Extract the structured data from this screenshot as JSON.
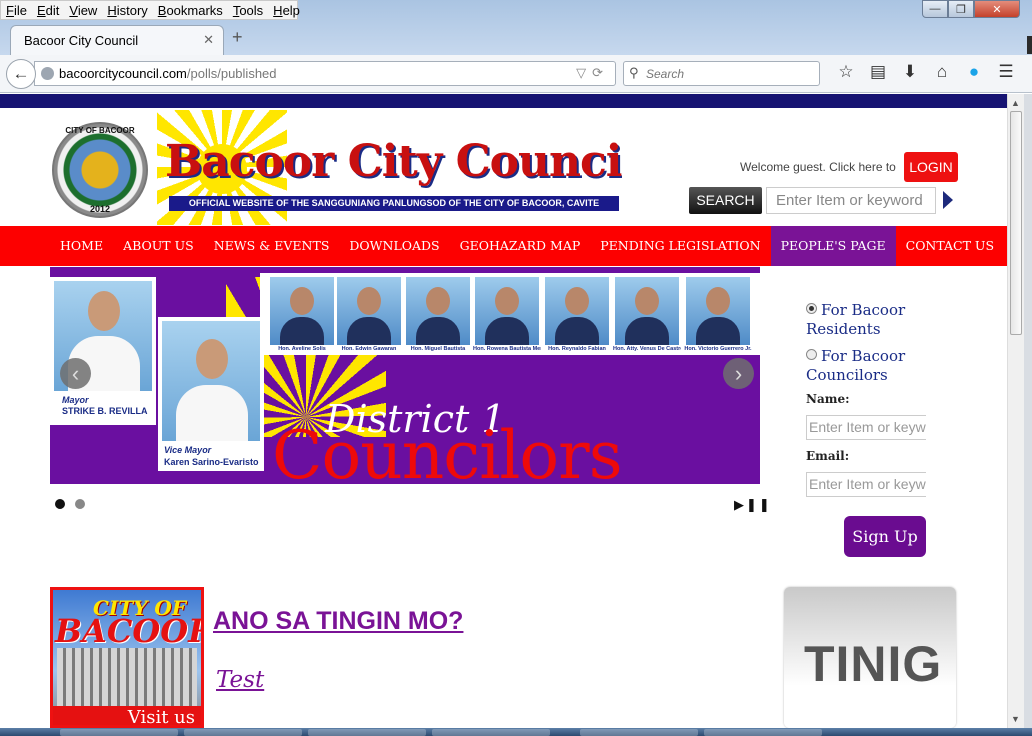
{
  "browser": {
    "menu": [
      "File",
      "Edit",
      "View",
      "History",
      "Bookmarks",
      "Tools",
      "Help"
    ],
    "tab_title": "Bacoor City Council",
    "url_domain": "bacoorcitycouncil.com",
    "url_path": "/polls/published",
    "search_placeholder": "Search",
    "tools_icons": [
      "bookmark-star-icon",
      "reading-list-icon",
      "download-icon",
      "home-icon",
      "skype-icon",
      "menu-icon"
    ]
  },
  "header": {
    "seal_text": "CITY OF BACOOR",
    "seal_year": "2012",
    "site_title": "Bacoor City Council",
    "site_subtitle": "OFFICIAL WEBSITE OF THE SANGGUNIANG PANLUNGSOD OF THE CITY OF BACOOR, CAVITE",
    "welcome": "Welcome guest. Click here to",
    "login_label": "LOGIN",
    "search_button": "SEARCH",
    "search_placeholder": "Enter Item or keyword"
  },
  "nav": {
    "items": [
      "HOME",
      "ABOUT US",
      "NEWS & EVENTS",
      "DOWNLOADS",
      "GEOHAZARD MAP",
      "PENDING LEGISLATION",
      "PEOPLE'S PAGE",
      "CONTACT US"
    ],
    "active_index": 6
  },
  "slider": {
    "mayor_role": "Mayor",
    "mayor_name": "STRIKE B. REVILLA",
    "vice_role": "Vice Mayor",
    "vice_name": "Karen Sarino-Evaristo",
    "councilors": [
      "Hon. Aveline Solis",
      "Hon. Edwin Gawaran",
      "Hon. Miguel Bautista",
      "Hon. Rowena Bautista Mendiola",
      "Hon. Reynaldo Fabian",
      "Hon. Atty. Venus De Castro",
      "Hon. Victorio Guerrero Jr."
    ],
    "heading1": "District 1",
    "heading2": "Councilors",
    "slide_count": 2,
    "current_slide": 1
  },
  "signup": {
    "option1": "For Bacoor Residents",
    "option1_line1": "For Bacoor",
    "option1_line2": "Residents",
    "option2_line1": "For Bacoor",
    "option2_line2": "Councilors",
    "selected": "option1",
    "name_label": "Name:",
    "name_placeholder": "Enter Item or keyword",
    "email_label": "Email:",
    "email_placeholder": "Enter Item or keyword",
    "button": "Sign Up"
  },
  "content": {
    "city_ad_line1": "CITY OF",
    "city_ad_line2": "BACOOR",
    "city_ad_visit": "Visit us",
    "poll_heading": "ANO SA TINGIN MO?",
    "poll_link": "Test",
    "tinig_label": "TINIG"
  },
  "colors": {
    "nav_red": "#fd0000",
    "active_purple": "#7a1396",
    "slider_purple": "#6a0fa0",
    "top_stripe": "#161372"
  }
}
